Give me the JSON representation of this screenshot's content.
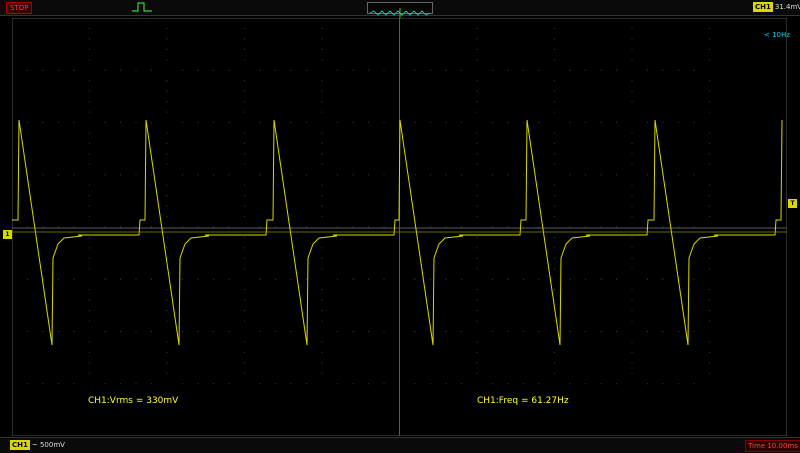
{
  "status": {
    "run_state": "STOP",
    "run_state_color": "#ff3333"
  },
  "trigger": {
    "channel": "CH1",
    "level": "31.4mV",
    "level_text": "31.4mV"
  },
  "channel": {
    "name": "CH1",
    "scale": "500mV",
    "scale_text": "~ 500mV",
    "color": "#d9d900"
  },
  "timebase": {
    "value": "10.00ms",
    "label": "Time 10.00ms"
  },
  "display": {
    "freq_indicator": "< 10Hz",
    "trace_color": "#d9d900",
    "grid_color": "#3a3a3a",
    "marker_ch1": "1",
    "marker_trigger": "T"
  },
  "measurements": [
    {
      "label": "CH1:Vrms = 330mV"
    },
    {
      "label": "CH1:Freq = 61.27Hz"
    }
  ]
}
